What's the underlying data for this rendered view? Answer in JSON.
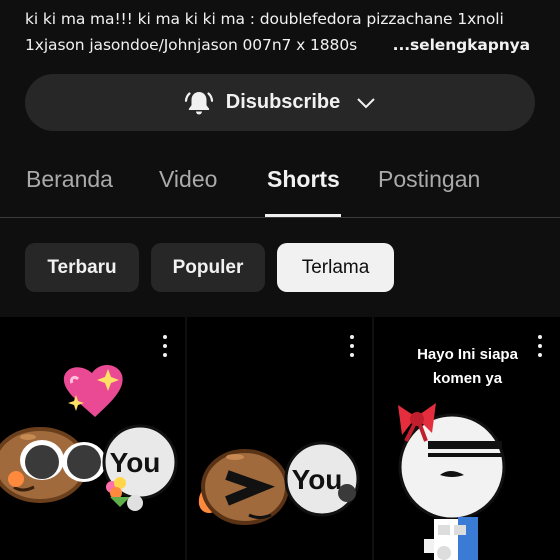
{
  "description": {
    "line1": "ki ki ma ma!!! ki ma ki ki ma : doublefedora pizzachane 1xnoli",
    "line2": "1xjason jasondoe/Johnjason 007n7 x 1880s",
    "more_label": "...selengkapnya"
  },
  "subscribe": {
    "label": "Disubscribe",
    "bell_icon": "bell-ringing-icon",
    "chevron_icon": "chevron-down-icon"
  },
  "tabs": [
    {
      "label": "Beranda",
      "active": false
    },
    {
      "label": "Video",
      "active": false
    },
    {
      "label": "Shorts",
      "active": true
    },
    {
      "label": "Postingan",
      "active": false
    }
  ],
  "filters": [
    {
      "label": "Terbaru",
      "active": false
    },
    {
      "label": "Populer",
      "active": false
    },
    {
      "label": "Terlama",
      "active": true
    }
  ],
  "shorts": [
    {
      "overlay_text": "",
      "sticker_text": "You"
    },
    {
      "overlay_text": "",
      "sticker_text": "You"
    },
    {
      "overlay_text_line1": "Hayo Ini siapa",
      "overlay_text_line2": "komen ya",
      "sticker_text": ""
    }
  ],
  "colors": {
    "background": "#0f0f0f",
    "surface": "#272727",
    "text_primary": "#f1f1f1",
    "text_secondary": "#aaaaaa"
  }
}
